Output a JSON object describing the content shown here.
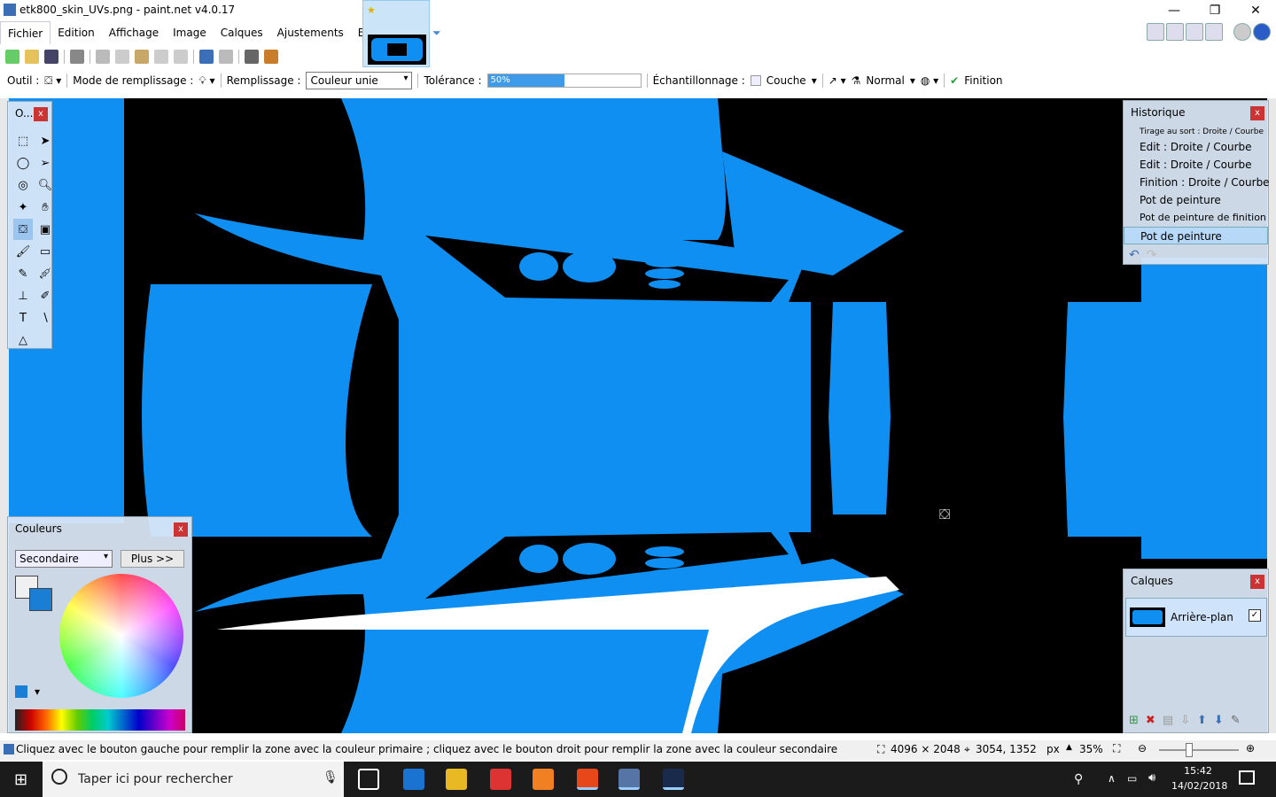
{
  "window": {
    "title": "etk800_skin_UVs.png - paint.net v4.0.17"
  },
  "menu": [
    "Fichier",
    "Edition",
    "Affichage",
    "Image",
    "Calques",
    "Ajustements",
    "Effets"
  ],
  "toolbar2": {
    "tool_label": "Outil :",
    "fill_mode_label": "Mode de remplissage :",
    "fill_label": "Remplissage :",
    "fill_value": "Couleur unie",
    "tolerance_label": "Tolérance :",
    "tolerance_value": "50%",
    "tolerance_fraction": 0.5,
    "sampling_label": "Échantillonnage :",
    "sampling_value": "Couche",
    "blend_value": "Normal",
    "finish_label": "Finition"
  },
  "tools_panel": {
    "title": "O..."
  },
  "history": {
    "title": "Historique",
    "items": [
      "Tirage au sort : Droite / Courbe",
      "Edit : Droite / Courbe",
      "Edit : Droite / Courbe",
      "Finition : Droite / Courbe",
      "Pot de peinture",
      "Pot de peinture de finition",
      "Pot de peinture"
    ]
  },
  "colors_panel": {
    "title": "Couleurs",
    "select_value": "Secondaire",
    "more_button": "Plus >>"
  },
  "layers": {
    "title": "Calques",
    "items": [
      {
        "name": "Arrière-plan",
        "visible": true
      }
    ]
  },
  "status": {
    "hint": "Cliquez avec le bouton gauche pour remplir la zone avec la couleur primaire ; cliquez avec le bouton droit pour remplir la zone avec la couleur secondaire",
    "image_size": "4096 × 2048",
    "cursor_pos": "3054, 1352",
    "unit": "px",
    "zoom": "35%"
  },
  "taskbar": {
    "search_placeholder": "Taper ici pour rechercher",
    "time": "15:42",
    "date": "14/02/2018"
  },
  "colors": {
    "accent": "#0f8ff2",
    "primary": "#f0f0f0",
    "secondary": "#1a7fd4"
  }
}
